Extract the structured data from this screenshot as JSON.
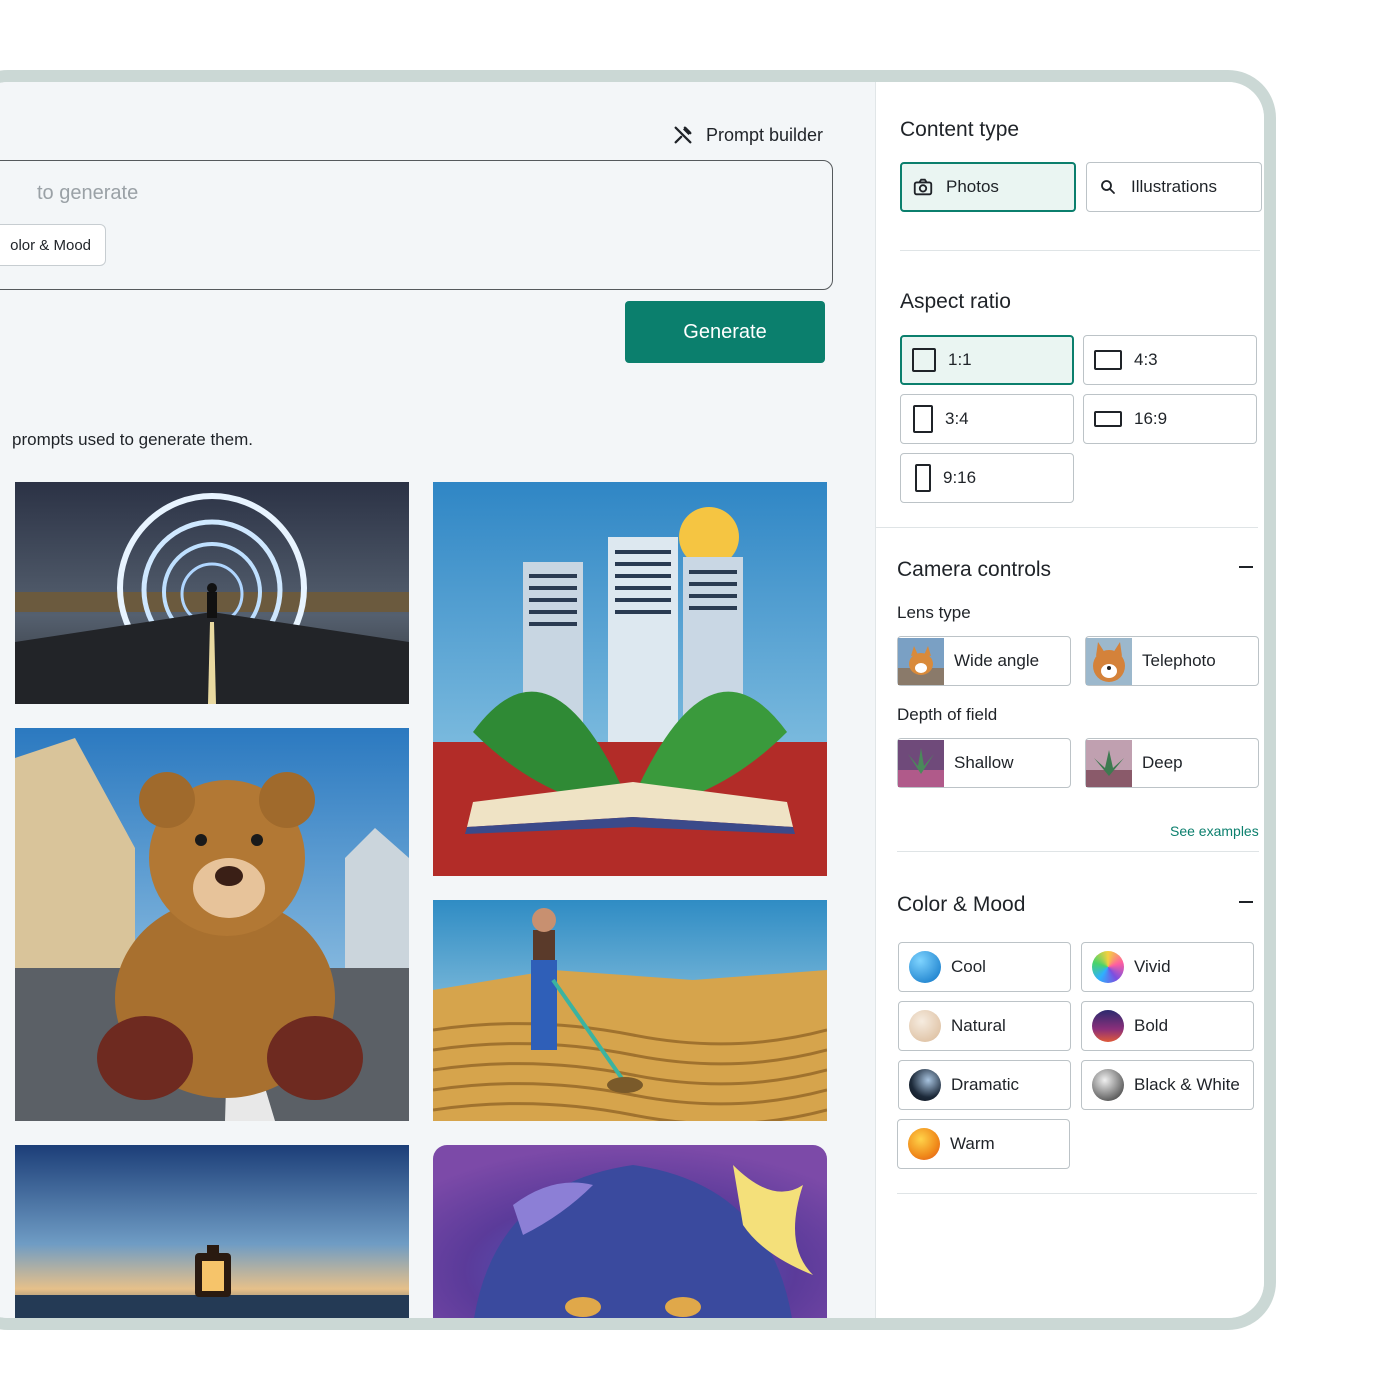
{
  "main": {
    "prompt_builder_label": "Prompt builder",
    "prompt_placeholder": "to generate",
    "chip_label": "olor & Mood",
    "generate_label": "Generate",
    "caption": "prompts used to generate them."
  },
  "panel": {
    "content_type": {
      "title": "Content type",
      "options": [
        {
          "label": "Photos",
          "icon": "camera-icon",
          "selected": true
        },
        {
          "label": "Illustrations",
          "icon": "search-icon",
          "selected": false
        }
      ]
    },
    "aspect_ratio": {
      "title": "Aspect ratio",
      "options": [
        {
          "label": "1:1",
          "selected": true
        },
        {
          "label": "4:3",
          "selected": false
        },
        {
          "label": "3:4",
          "selected": false
        },
        {
          "label": "16:9",
          "selected": false
        },
        {
          "label": "9:16",
          "selected": false
        }
      ]
    },
    "camera_controls": {
      "title": "Camera controls",
      "lens_type_label": "Lens type",
      "lens_options": [
        "Wide angle",
        "Telephoto"
      ],
      "depth_label": "Depth of field",
      "depth_options": [
        "Shallow",
        "Deep"
      ],
      "see_examples": "See examples"
    },
    "color_mood": {
      "title": "Color & Mood",
      "options": [
        {
          "label": "Cool",
          "color": "#1b8fd6"
        },
        {
          "label": "Vivid",
          "color": "#b84fd8"
        },
        {
          "label": "Natural",
          "color": "#e9d3b8"
        },
        {
          "label": "Bold",
          "color": "#5a2c7a"
        },
        {
          "label": "Dramatic",
          "color": "#1d2a3a"
        },
        {
          "label": "Black & White",
          "color": "#8b8b8b"
        },
        {
          "label": "Warm",
          "color": "#f0a020"
        }
      ]
    }
  },
  "colors": {
    "accent": "#0b7f6d",
    "selected_bg": "#eaf5f2",
    "frame": "#cbd8d5"
  }
}
